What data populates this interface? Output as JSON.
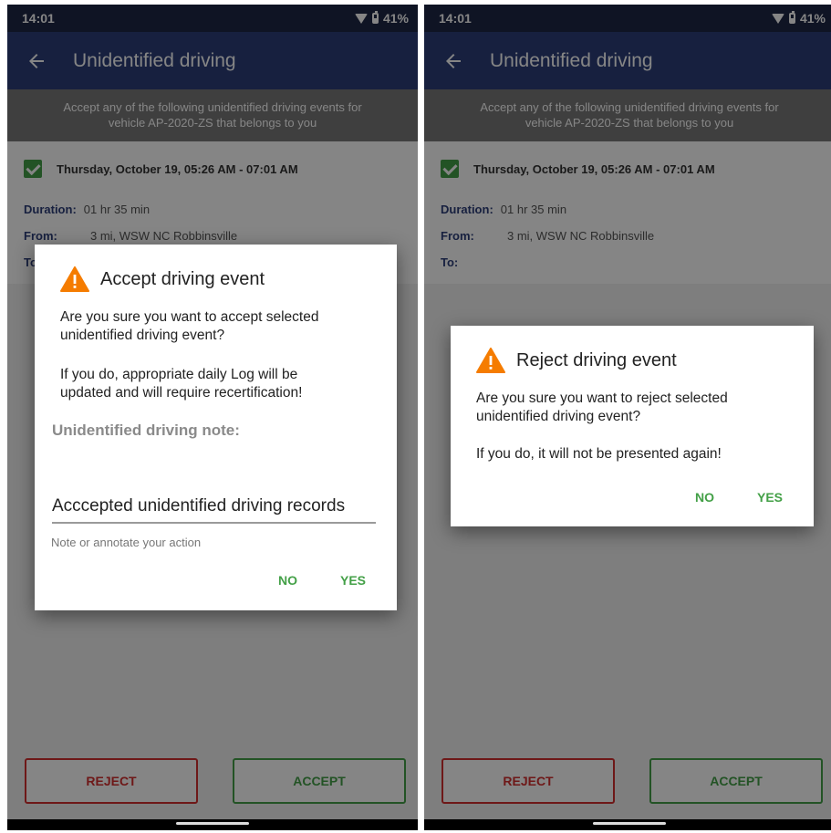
{
  "status_bar": {
    "time": "14:01",
    "battery": "41%"
  },
  "app_bar": {
    "title": "Unidentified driving"
  },
  "banner": {
    "line1": "Accept any of the following unidentified driving events for",
    "line2": "vehicle AP-2020-ZS that belongs to you"
  },
  "event": {
    "date": "Thursday, October 19, 05:26 AM - 07:01 AM",
    "duration_label": "Duration:",
    "duration_value": "01 hr 35 min",
    "from_label": "From:",
    "from_value": "3 mi, WSW NC Robbinsville",
    "to_label": "To:"
  },
  "buttons": {
    "reject": "REJECT",
    "accept": "ACCEPT"
  },
  "accept_dialog": {
    "title": "Accept driving event",
    "message1_line1": "Are you sure you want to accept selected",
    "message1_line2": "unidentified driving event?",
    "message2_line1": "If you do, appropriate daily Log will be",
    "message2_line2": "updated and will require recertification!",
    "note_label": "Unidentified driving note:",
    "note_value": "Acccepted unidentified driving records",
    "helper": "Note or annotate your action",
    "no": "NO",
    "yes": "YES"
  },
  "reject_dialog": {
    "title": "Reject driving event",
    "message1_line1": "Are you sure you want to reject selected",
    "message1_line2": "unidentified driving event?",
    "message2": "If you do, it will not be presented again!",
    "no": "NO",
    "yes": "YES"
  },
  "colors": {
    "appbar": "#2c3e7a",
    "statusbar": "#1e2746",
    "accent_green": "#43a047",
    "reject_red": "#d32f2f",
    "warning_orange": "#f57c00"
  },
  "icons": [
    "back-arrow-icon",
    "wifi-icon",
    "battery-icon",
    "checkbox-icon",
    "warning-icon"
  ]
}
